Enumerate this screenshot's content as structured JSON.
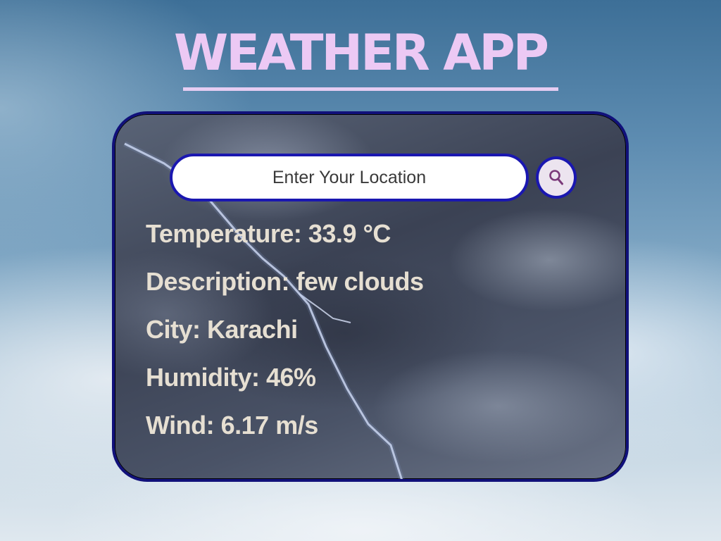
{
  "header": {
    "title": "WEATHER APP"
  },
  "search": {
    "placeholder": "Enter Your Location",
    "icon": "search-icon"
  },
  "weather": {
    "temperature": "Temperature: 33.9 °C",
    "description": "Description: few clouds",
    "city": "City: Karachi",
    "humidity": "Humidity: 46%",
    "wind": "Wind: 6.17 m/s"
  },
  "colors": {
    "title": "#ecc9f4",
    "card_border": "#11117a",
    "input_border": "#1a17b0",
    "info_text": "#e6dfd2",
    "search_icon": "#7b3a7a"
  }
}
